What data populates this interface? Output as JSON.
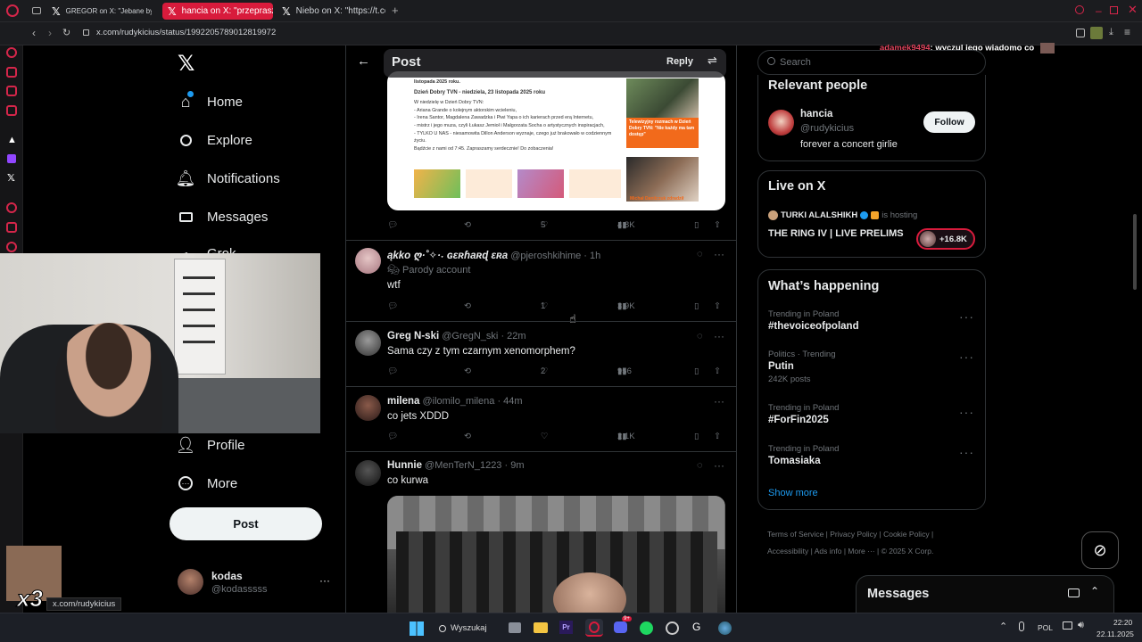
{
  "browser": {
    "tabs": [
      {
        "label": "GREGOR on X: \"Jebane byd",
        "active": false
      },
      {
        "label": "hancia on X: \"przeprasza",
        "active": true
      },
      {
        "label": "Niebo on X: \"https://t.co/",
        "active": false
      }
    ],
    "url": "x.com/rudykicius/status/1992205789012819972"
  },
  "chat_overlay": {
    "user": "adamek9494",
    "message": ": wyczul jego wiadomo co"
  },
  "nav": {
    "items": [
      {
        "label": "Home",
        "icon": "home-icon"
      },
      {
        "label": "Explore",
        "icon": "search-icon"
      },
      {
        "label": "Notifications",
        "icon": "bell-icon"
      },
      {
        "label": "Messages",
        "icon": "envelope-icon"
      },
      {
        "label": "Grok",
        "icon": "grok-icon"
      },
      {
        "label": "Profile",
        "icon": "person-icon"
      },
      {
        "label": "More",
        "icon": "more-circle-icon"
      }
    ],
    "post_button": "Post",
    "account": {
      "name": "kodas",
      "handle": "@kodasssss"
    }
  },
  "header": {
    "title": "Post",
    "reply_label": "Reply"
  },
  "first_tweet": {
    "image_lines": [
      "listopada 2025 roku.",
      "Dzień Dobry TVN - niedziela, 23 listopada 2025 roku",
      "W niedzielę w Dzień Dobry TVN:",
      "- Ariana Grande o kolejnym aktorskim wcieleniu,",
      "- Irena Santor, Magdalena Zawadzka i Piwi Yapa o ich karierach przed erą Internetu,",
      "- mistrz i jego muza, czyli Łukasz Jemioł i Małgorzata Socha o artystycznych inspiracjach,",
      "- TYLKO U NAS - niesamowita Dillon Anderson wyznaje, czego już brakowało w codziennym życiu.",
      "Bądźcie z nami od 7:45. Zapraszamy serdecznie! Do zobaczenia!"
    ],
    "image_caption_1": "Telewizyjny rozmach w Dzień Dobry TVN: \"Nie każdy ma tam dostęp\"",
    "image_caption_2": "Michał Danilczuk zdradził",
    "likes": "5",
    "views": "4.8K"
  },
  "tweets": [
    {
      "name": "ąkko ღ·˚✧·˖ ɢɛʀɦaʀɖ ɛʀa",
      "handle": "@pjeroshkihime",
      "time": "· 1h",
      "badge": "Parody account",
      "text": "wtf",
      "likes": "1",
      "views": "3.9K"
    },
    {
      "name": "Greg N-ski",
      "handle": "@GregN_ski",
      "time": "· 22m",
      "text": "Sama czy z tym czarnym xenomorphem?",
      "likes": "2",
      "views": "956"
    },
    {
      "name": "milena",
      "handle": "@ilomilo_milena",
      "time": "· 44m",
      "text": "co jets XDDD",
      "likes": "",
      "views": "2.1K"
    },
    {
      "name": "Hunnie",
      "handle": "@MenTerN_1223",
      "time": "· 9m",
      "text": "co kurwa",
      "likes": "",
      "views": ""
    }
  ],
  "search": {
    "placeholder": "Search"
  },
  "relevant_people": {
    "title": "Relevant people",
    "name": "hancia",
    "handle": "@rudykicius",
    "bio": "forever a concert girlie",
    "follow_label": "Follow"
  },
  "live": {
    "title": "Live on X",
    "host": "TURKI ALALSHIKH",
    "hosting": "is hosting",
    "event": "THE RING IV | LIVE PRELIMS",
    "count": "+16.8K"
  },
  "happening": {
    "title": "What’s happening",
    "trends": [
      {
        "label": "Trending in Poland",
        "title": "#thevoiceofpoland",
        "posts": ""
      },
      {
        "label": "Politics · Trending",
        "title": "Putin",
        "posts": "242K posts"
      },
      {
        "label": "Trending in Poland",
        "title": "#ForFin2025",
        "posts": ""
      },
      {
        "label": "Trending in Poland",
        "title": "Tomasiaka",
        "posts": ""
      }
    ],
    "show_more": "Show more"
  },
  "footer": {
    "links": [
      "Terms of Service",
      "Privacy Policy",
      "Cookie Policy",
      "Accessibility",
      "Ads info",
      "More ···",
      "© 2025 X Corp."
    ]
  },
  "messages_drawer": {
    "title": "Messages"
  },
  "status_url": "x.com/rudykicius",
  "emote_text": "x3",
  "taskbar": {
    "search": "Wyszukaj",
    "lang": "POL",
    "time": "22:20",
    "date": "22.11.2025",
    "discord_badge": "9+"
  },
  "colors": {
    "accent": "#d81b3c",
    "link": "#1d9bf0",
    "bg": "#000000",
    "opera_red": "#d4264a"
  }
}
